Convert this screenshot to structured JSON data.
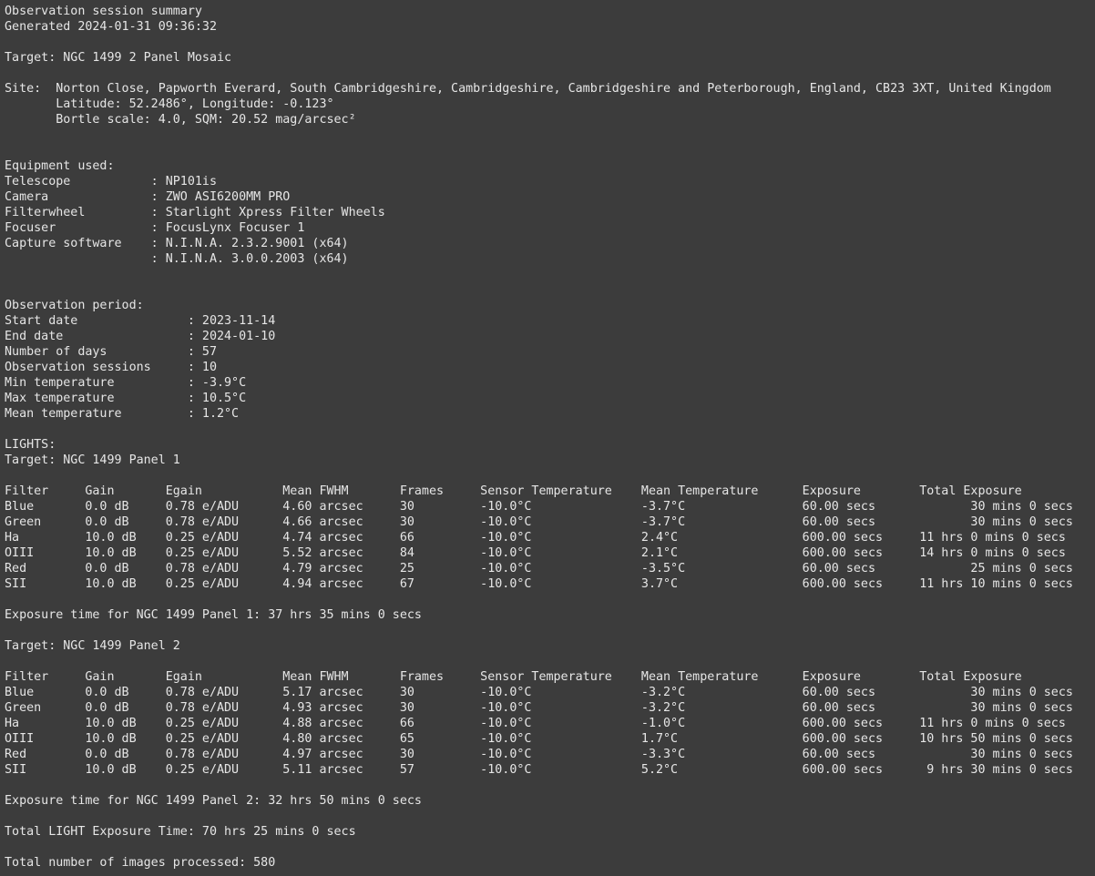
{
  "report": {
    "title": "Observation session summary",
    "generated": "Generated 2024-01-31 09:36:32",
    "target": "Target: NGC 1499 2 Panel Mosaic",
    "site_line1": "Site:  Norton Close, Papworth Everard, South Cambridgeshire, Cambridgeshire, Cambridgeshire and Peterborough, England, CB23 3XT, United Kingdom",
    "site_line2": "       Latitude: 52.2486°, Longitude: -0.123°",
    "site_line3": "       Bortle scale: 4.0, SQM: 20.52 mag/arcsec²",
    "equipment": {
      "header": "Equipment used:",
      "rows": [
        "Telescope           : NP101is",
        "Camera              : ZWO ASI6200MM PRO",
        "Filterwheel         : Starlight Xpress Filter Wheels",
        "Focuser             : FocusLynx Focuser 1",
        "Capture software    : N.I.N.A. 2.3.2.9001 (x64)",
        "                    : N.I.N.A. 3.0.0.2003 (x64)"
      ]
    },
    "period": {
      "header": "Observation period:",
      "rows": [
        "Start date               : 2023-11-14",
        "End date                 : 2024-01-10",
        "Number of days           : 57",
        "Observation sessions     : 10",
        "Min temperature          : -3.9°C",
        "Max temperature          : 10.5°C",
        "Mean temperature         : 1.2°C"
      ]
    },
    "lights_header": "LIGHTS:",
    "panel1": {
      "target": "Target: NGC 1499 Panel 1",
      "table_header": "Filter     Gain       Egain           Mean FWHM       Frames     Sensor Temperature    Mean Temperature      Exposure        Total Exposure",
      "rows": [
        "Blue       0.0 dB     0.78 e/ADU      4.60 arcsec     30         -10.0°C               -3.7°C                60.00 secs             30 mins 0 secs",
        "Green      0.0 dB     0.78 e/ADU      4.66 arcsec     30         -10.0°C               -3.7°C                60.00 secs             30 mins 0 secs",
        "Ha         10.0 dB    0.25 e/ADU      4.74 arcsec     66         -10.0°C               2.4°C                 600.00 secs     11 hrs 0 mins 0 secs",
        "OIII       10.0 dB    0.25 e/ADU      5.52 arcsec     84         -10.0°C               2.1°C                 600.00 secs     14 hrs 0 mins 0 secs",
        "Red        0.0 dB     0.78 e/ADU      4.79 arcsec     25         -10.0°C               -3.5°C                60.00 secs             25 mins 0 secs",
        "SII        10.0 dB    0.25 e/ADU      4.94 arcsec     67         -10.0°C               3.7°C                 600.00 secs     11 hrs 10 mins 0 secs"
      ],
      "exposure_total": "Exposure time for NGC 1499 Panel 1: 37 hrs 35 mins 0 secs"
    },
    "panel2": {
      "target": "Target: NGC 1499 Panel 2",
      "table_header": "Filter     Gain       Egain           Mean FWHM       Frames     Sensor Temperature    Mean Temperature      Exposure        Total Exposure",
      "rows": [
        "Blue       0.0 dB     0.78 e/ADU      5.17 arcsec     30         -10.0°C               -3.2°C                60.00 secs             30 mins 0 secs",
        "Green      0.0 dB     0.78 e/ADU      4.93 arcsec     30         -10.0°C               -3.2°C                60.00 secs             30 mins 0 secs",
        "Ha         10.0 dB    0.25 e/ADU      4.88 arcsec     66         -10.0°C               -1.0°C                600.00 secs     11 hrs 0 mins 0 secs",
        "OIII       10.0 dB    0.25 e/ADU      4.80 arcsec     65         -10.0°C               1.7°C                 600.00 secs     10 hrs 50 mins 0 secs",
        "Red        0.0 dB     0.78 e/ADU      4.97 arcsec     30         -10.0°C               -3.3°C                60.00 secs             30 mins 0 secs",
        "SII        10.0 dB    0.25 e/ADU      5.11 arcsec     57         -10.0°C               5.2°C                 600.00 secs      9 hrs 30 mins 0 secs"
      ],
      "exposure_total": "Exposure time for NGC 1499 Panel 2: 32 hrs 50 mins 0 secs"
    },
    "total_light": "Total LIGHT Exposure Time: 70 hrs 25 mins 0 secs",
    "total_images": "Total number of images processed: 580"
  },
  "colors": {
    "background": "#3c3c3c",
    "text": "#e6e6e6"
  }
}
